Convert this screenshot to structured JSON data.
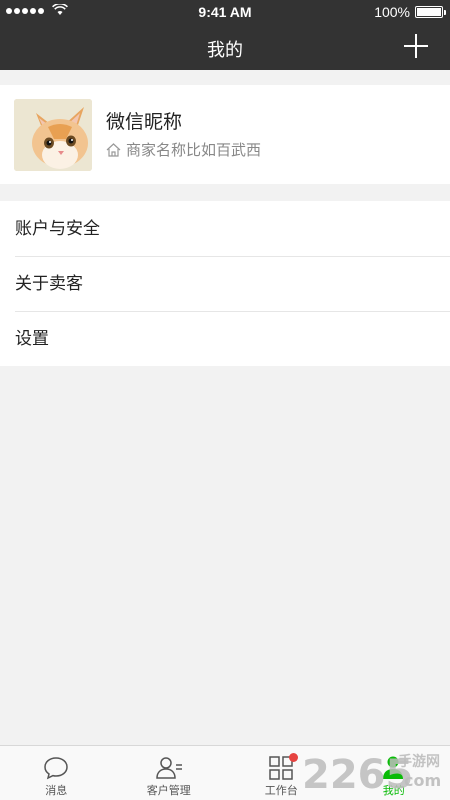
{
  "status_bar": {
    "time": "9:41 AM",
    "battery": "100%"
  },
  "nav": {
    "title": "我的",
    "add_icon": "plus-icon"
  },
  "profile": {
    "nickname": "微信昵称",
    "shop_name": "商家名称比如百武西",
    "avatar": "cat-photo"
  },
  "menu": {
    "items": [
      {
        "label": "账户与安全"
      },
      {
        "label": "关于卖客"
      },
      {
        "label": "设置"
      }
    ]
  },
  "tabbar": {
    "tabs": [
      {
        "label": "消息",
        "icon": "chat-bubble-icon"
      },
      {
        "label": "客户管理",
        "icon": "customer-icon"
      },
      {
        "label": "工作台",
        "icon": "grid-icon",
        "badge": true
      },
      {
        "label": "我的",
        "icon": "person-icon",
        "active": true
      }
    ],
    "active_color": "#09bb07"
  },
  "watermark": {
    "brand": "2265",
    "sub1": "手游网",
    "sub2": "com"
  },
  "colors": {
    "header": "#333333",
    "background": "#f2f2f2",
    "badge": "#e64340"
  }
}
